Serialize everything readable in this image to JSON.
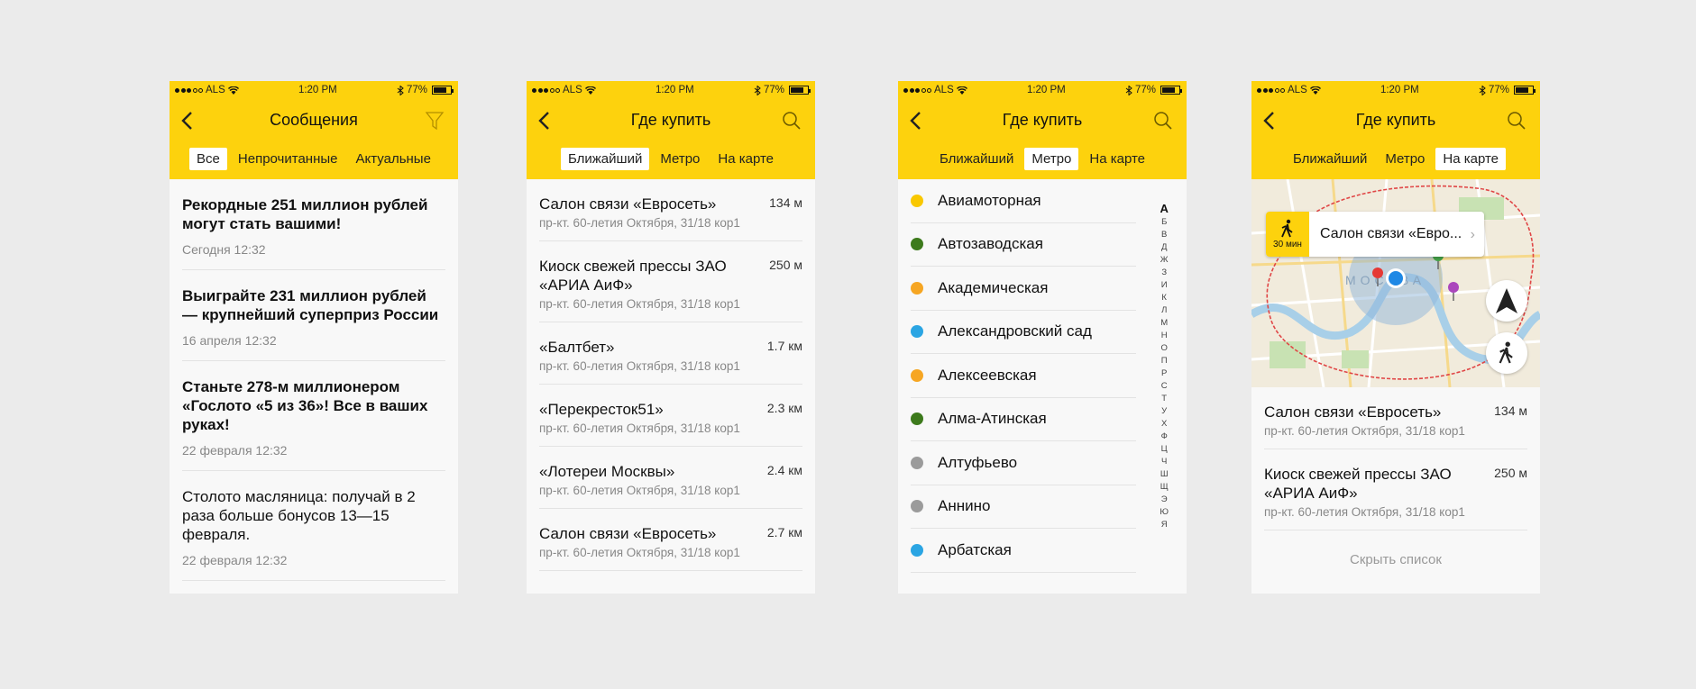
{
  "status": {
    "carrier": "ALS",
    "time": "1:20 PM",
    "battery": "77%"
  },
  "screen1": {
    "title": "Сообщения",
    "tabs": [
      "Все",
      "Непрочитанные",
      "Актуальные"
    ],
    "messages": [
      {
        "title": "Рекордные 251 миллион рублей могут стать вашими!",
        "date": "Сегодня 12:32"
      },
      {
        "title": "Выиграйте 231 миллион рублей — крупнейший суперприз России",
        "date": "16 апреля 12:32"
      },
      {
        "title": "Станьте 278-м миллионером «Гослото «5 из 36»! Все в ваших руках!",
        "date": "22 февраля 12:32"
      },
      {
        "title": "Столото масляница: получай в 2 раза  больше бонусов 13—15 февраля.",
        "date": "22 февраля 12:32"
      }
    ]
  },
  "screen2": {
    "title": "Где купить",
    "tabs": [
      "Ближайший",
      "Метро",
      "На карте"
    ],
    "shops": [
      {
        "name": "Салон связи «Евросеть»",
        "address": "пр-кт. 60-летия Октября, 31/18 кор1",
        "distance": "134 м"
      },
      {
        "name": "Киоск свежей прессы ЗАО «АРИА АиФ»",
        "address": "пр-кт. 60-летия Октября, 31/18 кор1",
        "distance": "250 м"
      },
      {
        "name": "«Балтбет»",
        "address": "пр-кт. 60-летия Октября, 31/18 кор1",
        "distance": "1.7 км"
      },
      {
        "name": "«Перекресток51»",
        "address": "пр-кт. 60-летия Октября, 31/18 кор1",
        "distance": "2.3 км"
      },
      {
        "name": "«Лотереи Москвы»",
        "address": "пр-кт. 60-летия Октября, 31/18 кор1",
        "distance": "2.4 км"
      },
      {
        "name": "Салон связи «Евросеть»",
        "address": "пр-кт. 60-летия Октября, 31/18 кор1",
        "distance": "2.7 км"
      }
    ]
  },
  "screen3": {
    "title": "Где купить",
    "tabs": [
      "Ближайший",
      "Метро",
      "На карте"
    ],
    "stations": [
      {
        "name": "Авиамоторная",
        "color": "#f9c800"
      },
      {
        "name": "Автозаводская",
        "color": "#3d7a1c"
      },
      {
        "name": "Академическая",
        "color": "#f6a623"
      },
      {
        "name": "Александровский сад",
        "color": "#2ba5e3"
      },
      {
        "name": "Алексеевская",
        "color": "#f6a623"
      },
      {
        "name": "Алма-Атинская",
        "color": "#3d7a1c"
      },
      {
        "name": "Алтуфьево",
        "color": "#9b9b9b"
      },
      {
        "name": "Аннино",
        "color": "#9b9b9b"
      },
      {
        "name": "Арбатская",
        "color": "#2ba5e3"
      }
    ],
    "alphabet": [
      "А",
      "Б",
      "В",
      "Д",
      "Ж",
      "З",
      "И",
      "К",
      "Л",
      "М",
      "Н",
      "О",
      "П",
      "Р",
      "С",
      "Т",
      "У",
      "Х",
      "Ф",
      "Ц",
      "Ч",
      "Ш",
      "Щ",
      "Э",
      "Ю",
      "Я"
    ]
  },
  "screen4": {
    "title": "Где купить",
    "tabs": [
      "Ближайший",
      "Метро",
      "На карте"
    ],
    "callout": {
      "walk_time": "30 мин",
      "name": "Салон связи «Евро..."
    },
    "map_label": "МОСКВА",
    "shops": [
      {
        "name": "Салон связи «Евросеть»",
        "address": "пр-кт. 60-летия Октября, 31/18 кор1",
        "distance": "134 м"
      },
      {
        "name": "Киоск свежей прессы ЗАО «АРИА АиФ»",
        "address": "пр-кт. 60-летия Октября, 31/18 кор1",
        "distance": "250 м"
      }
    ],
    "hide_label": "Скрыть список"
  },
  "colors": {
    "accent": "#fdd20d",
    "background": "#ebebeb",
    "screen": "#f8f8f8"
  }
}
